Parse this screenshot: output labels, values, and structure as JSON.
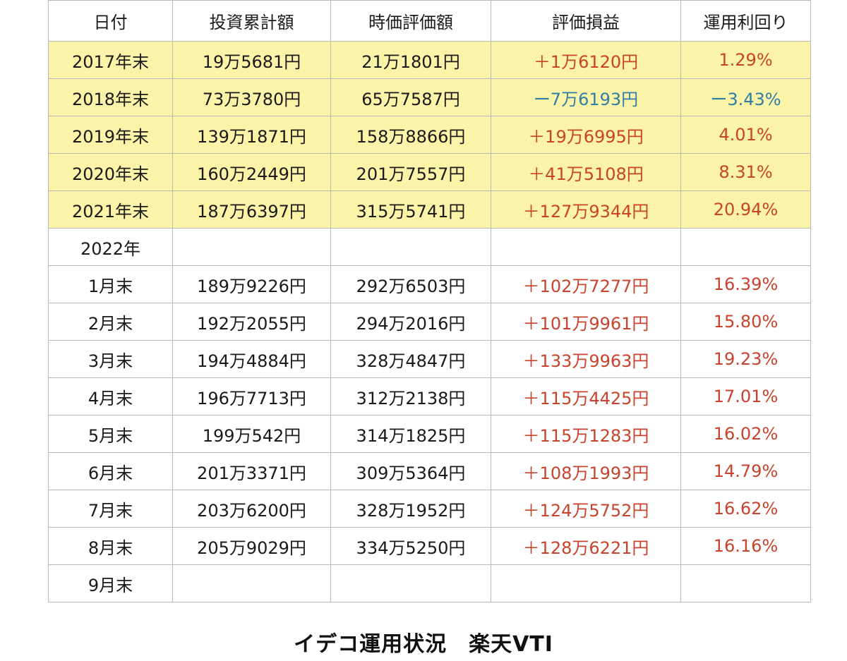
{
  "table": {
    "headers": [
      "日付",
      "投資累計額",
      "時価評価額",
      "評価損益",
      "運用利回り"
    ],
    "rows": [
      {
        "date": "2017年末",
        "invested": "19万5681円",
        "market": "21万1801円",
        "gain": "＋1万6120円",
        "yield": "1.29%",
        "highlight": true,
        "sign": "pos"
      },
      {
        "date": "2018年末",
        "invested": "73万3780円",
        "market": "65万7587円",
        "gain": "ー7万6193円",
        "yield": "ー3.43%",
        "highlight": true,
        "sign": "neg"
      },
      {
        "date": "2019年末",
        "invested": "139万1871円",
        "market": "158万8866円",
        "gain": "＋19万6995円",
        "yield": "4.01%",
        "highlight": true,
        "sign": "pos"
      },
      {
        "date": "2020年末",
        "invested": "160万2449円",
        "market": "201万7557円",
        "gain": "＋41万5108円",
        "yield": "8.31%",
        "highlight": true,
        "sign": "pos"
      },
      {
        "date": "2021年末",
        "invested": "187万6397円",
        "market": "315万5741円",
        "gain": "＋127万9344円",
        "yield": "20.94%",
        "highlight": true,
        "sign": "pos"
      },
      {
        "date": "2022年",
        "invested": "",
        "market": "",
        "gain": "",
        "yield": "",
        "highlight": false,
        "sign": "pos"
      },
      {
        "date": "1月末",
        "invested": "189万9226円",
        "market": "292万6503円",
        "gain": "＋102万7277円",
        "yield": "16.39%",
        "highlight": false,
        "sign": "pos"
      },
      {
        "date": "2月末",
        "invested": "192万2055円",
        "market": "294万2016円",
        "gain": "＋101万9961円",
        "yield": "15.80%",
        "highlight": false,
        "sign": "pos"
      },
      {
        "date": "3月末",
        "invested": "194万4884円",
        "market": "328万4847円",
        "gain": "＋133万9963円",
        "yield": "19.23%",
        "highlight": false,
        "sign": "pos"
      },
      {
        "date": "4月末",
        "invested": "196万7713円",
        "market": "312万2138円",
        "gain": "＋115万4425円",
        "yield": "17.01%",
        "highlight": false,
        "sign": "pos"
      },
      {
        "date": "5月末",
        "invested": "199万542円",
        "market": "314万1825円",
        "gain": "＋115万1283円",
        "yield": "16.02%",
        "highlight": false,
        "sign": "pos"
      },
      {
        "date": "6月末",
        "invested": "201万3371円",
        "market": "309万5364円",
        "gain": "＋108万1993円",
        "yield": "14.79%",
        "highlight": false,
        "sign": "pos"
      },
      {
        "date": "7月末",
        "invested": "203万6200円",
        "market": "328万1952円",
        "gain": "＋124万5752円",
        "yield": "16.62%",
        "highlight": false,
        "sign": "pos"
      },
      {
        "date": "8月末",
        "invested": "205万9029円",
        "market": "334万5250円",
        "gain": "＋128万6221円",
        "yield": "16.16%",
        "highlight": false,
        "sign": "pos"
      },
      {
        "date": "9月末",
        "invested": "",
        "market": "",
        "gain": "",
        "yield": "",
        "highlight": false,
        "sign": "pos"
      }
    ]
  },
  "caption": "イデコ運用状況　楽天VTI",
  "colors": {
    "highlight_row": "#fbf3a7",
    "positive": "#c9432c",
    "negative": "#2e7fa8",
    "grid": "#b8b8b8"
  }
}
